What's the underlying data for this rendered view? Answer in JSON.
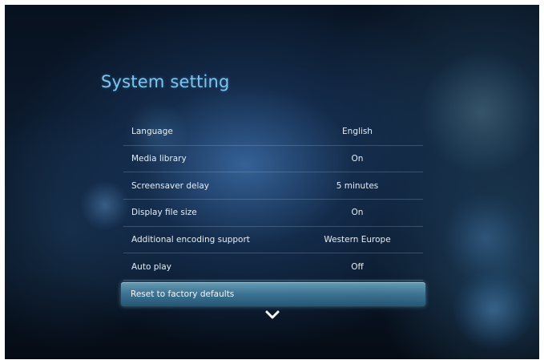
{
  "page": {
    "title": "System setting"
  },
  "settings": [
    {
      "label": "Language",
      "value": "English"
    },
    {
      "label": "Media library",
      "value": "On"
    },
    {
      "label": "Screensaver delay",
      "value": "5 minutes"
    },
    {
      "label": "Display file size",
      "value": "On"
    },
    {
      "label": "Additional encoding support",
      "value": "Western Europe"
    },
    {
      "label": "Auto play",
      "value": "Off"
    }
  ],
  "selected_item": {
    "label": "Reset to factory defaults"
  },
  "icons": {
    "more": "chevron-down-icon"
  },
  "colors": {
    "title": "#7fc4ee",
    "highlight": "#5fa8c8",
    "text": "#e4edf5"
  }
}
